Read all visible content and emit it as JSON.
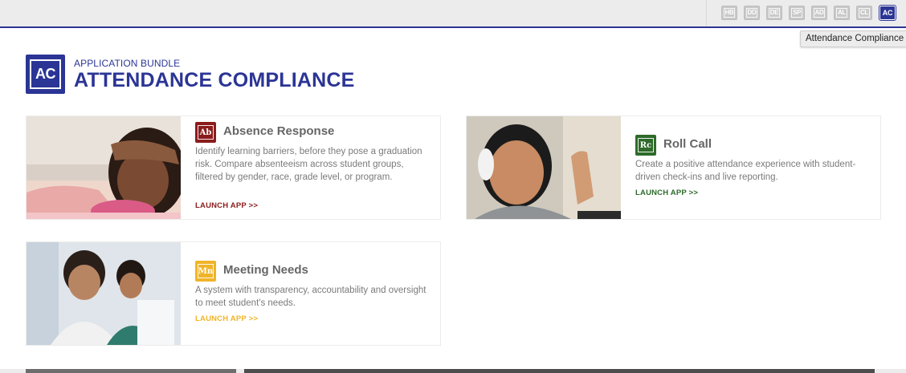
{
  "bundle_switcher": {
    "items": [
      {
        "code": "HB",
        "active": false
      },
      {
        "code": "DD",
        "active": false
      },
      {
        "code": "DE",
        "active": false
      },
      {
        "code": "SP",
        "active": false
      },
      {
        "code": "AD",
        "active": false
      },
      {
        "code": "AL",
        "active": false
      },
      {
        "code": "CL",
        "active": false
      },
      {
        "code": "AC",
        "active": true
      }
    ],
    "tooltip": "Attendance Compliance"
  },
  "header": {
    "logo_code": "AC",
    "eyebrow": "APPLICATION BUNDLE",
    "title": "ATTENDANCE COMPLIANCE"
  },
  "apps": [
    {
      "code": "Ab",
      "name": "Absence Response",
      "description": "Identify learning barriers, before they pose a graduation risk. Compare absenteeism across student groups, filtered by gender, race, grade level, or program.",
      "launch_label": "LAUNCH APP >>",
      "color": "#8b1c1c"
    },
    {
      "code": "Rc",
      "name": "Roll Call",
      "description": "Create a positive attendance experience with student-driven check-ins and live reporting.",
      "launch_label": "LAUNCH APP >>",
      "color": "#2e6b2a"
    },
    {
      "code": "Mn",
      "name": "Meeting Needs",
      "description": "A system with transparency, accountability and oversight to meet student's needs.",
      "launch_label": "LAUNCH APP >>",
      "color": "#f0b429"
    }
  ],
  "colors": {
    "brand": "#2b3595",
    "topbar": "#ececec"
  }
}
